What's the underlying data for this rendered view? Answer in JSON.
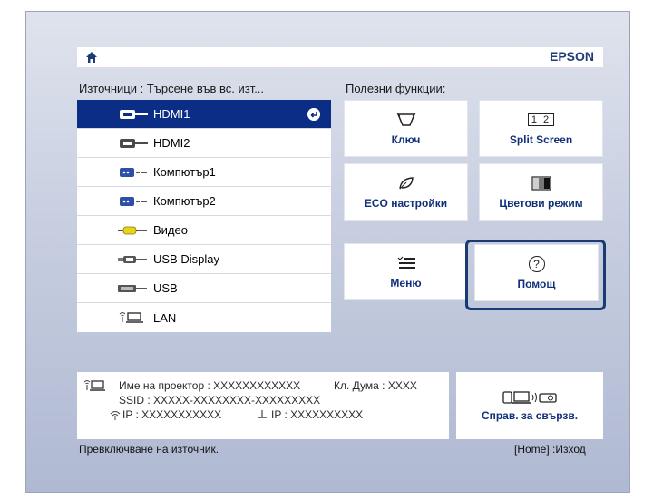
{
  "header": {
    "brand": "EPSON",
    "home_icon": "home-icon"
  },
  "sources": {
    "heading": "Източници : Търсене във вс. изт...",
    "items": [
      {
        "label": "HDMI1",
        "icon": "hdmi-port-icon",
        "selected": true
      },
      {
        "label": "HDMI2",
        "icon": "hdmi-port-icon"
      },
      {
        "label": "Компютър1",
        "icon": "vga-port-icon"
      },
      {
        "label": "Компютър2",
        "icon": "vga-port-icon"
      },
      {
        "label": "Видео",
        "icon": "rca-video-icon"
      },
      {
        "label": "USB Display",
        "icon": "usb-display-icon"
      },
      {
        "label": "USB",
        "icon": "usb-icon"
      },
      {
        "label": "LAN",
        "icon": "lan-network-icon"
      }
    ]
  },
  "functions": {
    "heading": "Полезни функции:",
    "key": "Ключ",
    "split": "Split Screen",
    "split_icon_text": "1 2",
    "eco": "ECO настройки",
    "color_mode": "Цветови режим",
    "menu": "Меню",
    "help": "Помощ",
    "help_icon_text": "?"
  },
  "info": {
    "projector_name": "Име на проектор : XXXXXXXXXXXX",
    "keyword": "Кл. Дума : XXXX",
    "ssid": "SSID  :  XXXXX-XXXXXXXX-XXXXXXXXX",
    "ip_wireless": "IP  :  XXXXXXXXXXX",
    "ip_wired": "IP  :  XXXXXXXXXX"
  },
  "connection": {
    "label": "Справ. за свързв."
  },
  "footer": {
    "left": "Превключване на източник.",
    "right": "[Home] :Изход"
  },
  "colors": {
    "selected": "#0b2d86",
    "accent_text": "#12307a",
    "focus": "#1b3a73"
  }
}
